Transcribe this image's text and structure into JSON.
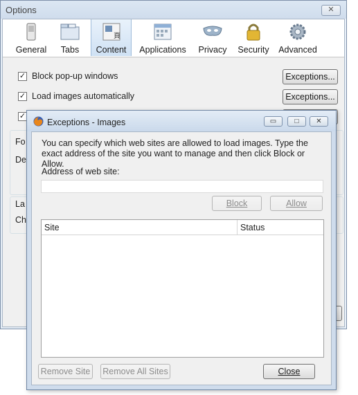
{
  "options_window": {
    "title": "Options",
    "close_glyph": "✕",
    "toolbar": [
      {
        "label": "General",
        "icon": "switch-icon"
      },
      {
        "label": "Tabs",
        "icon": "tabs-folder-icon"
      },
      {
        "label": "Content",
        "icon": "content-page-icon",
        "selected": true
      },
      {
        "label": "Applications",
        "icon": "applications-window-icon"
      },
      {
        "label": "Privacy",
        "icon": "privacy-mask-icon"
      },
      {
        "label": "Security",
        "icon": "security-padlock-icon"
      },
      {
        "label": "Advanced",
        "icon": "advanced-gear-icon"
      }
    ],
    "checkboxes": [
      {
        "label": "Block pop-up windows",
        "checked": true,
        "check_glyph": "✓"
      },
      {
        "label": "Load images automatically",
        "checked": true,
        "check_glyph": "✓"
      },
      {
        "label": "",
        "checked": true,
        "check_glyph": "✓"
      }
    ],
    "exceptions_button_label": "Exceptions...",
    "partial_labels": [
      "Fo",
      "De",
      "La",
      "Ch"
    ]
  },
  "exceptions_dialog": {
    "title": "Exceptions - Images",
    "minimize_glyph": "▭",
    "maximize_glyph": "□",
    "close_glyph": "✕",
    "description": "You can specify which web sites are allowed to load images. Type the exact address of the site you want to manage and then click Block or Allow.",
    "address_label": "Address of web site:",
    "address_value": "",
    "block_label": "Block",
    "allow_label": "Allow",
    "columns": {
      "site": "Site",
      "status": "Status"
    },
    "rows": [],
    "remove_site_label": "Remove Site",
    "remove_all_label": "Remove All Sites",
    "close_label": "Close"
  }
}
